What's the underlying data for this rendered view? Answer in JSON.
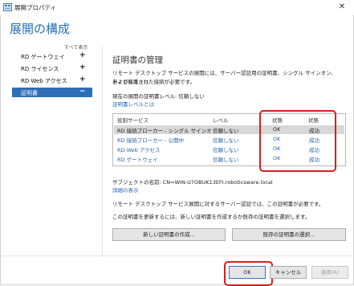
{
  "window": {
    "title": "展開プロパティ",
    "close_glyph": "✕"
  },
  "heading": "展開の構成",
  "nav": {
    "show_all": "すべて表示",
    "items": [
      {
        "label": "RD ゲートウェイ",
        "sign": "+"
      },
      {
        "label": "RD ライセンス",
        "sign": "+"
      },
      {
        "label": "RD Web アクセス",
        "sign": "+"
      },
      {
        "label": "証明書",
        "sign": "−",
        "selected": true
      }
    ]
  },
  "content": {
    "section_title": "証明書の管理",
    "desc_line1": "リモート デスクトップ サービスの展開には、サーバー認証用の証明書、シングル サインオン、およびセキュリ",
    "desc_line2": "ティで保護された接続が必要です。",
    "current_level": "現在の展開の証明書レベル: 信頼しない",
    "level_link": "証明書レベルとは",
    "table": {
      "headers": [
        "役割サービス",
        "レベル",
        "状態",
        "状態"
      ],
      "rows": [
        [
          "RD 接続ブローカー - シングル サインオンを有効にする",
          "信頼しない",
          "OK",
          "成功"
        ],
        [
          "RD 接続ブローカー - 公開中",
          "信頼しない",
          "OK",
          "成功"
        ],
        [
          "RD Web アクセス",
          "信頼しない",
          "OK",
          "成功"
        ],
        [
          "RD ゲートウェイ",
          "信頼しない",
          "OK",
          "成功"
        ]
      ]
    },
    "subject_name": "サブジェクトの名前: CN=WIN-U7OBUK13EFI.roboticsware.local",
    "details_link": "詳細の表示",
    "auth_note": "リモート デスクトップ サービス展開に対するサーバー認証では、この証明書が必要です。",
    "update_note": "この証明書を更新するには、新しい証明書を作成するか既存の証明書を選択します。",
    "create_button": "新しい証明書の作成...",
    "select_button": "既存の証明書の選択..."
  },
  "footer": {
    "ok": "OK",
    "cancel": "キャンセル",
    "apply": "適用(A)"
  },
  "colors": {
    "accent": "#2e6fb8",
    "heading": "#2a6fb4",
    "link": "#2565ad",
    "highlight": "#d61f1f"
  }
}
